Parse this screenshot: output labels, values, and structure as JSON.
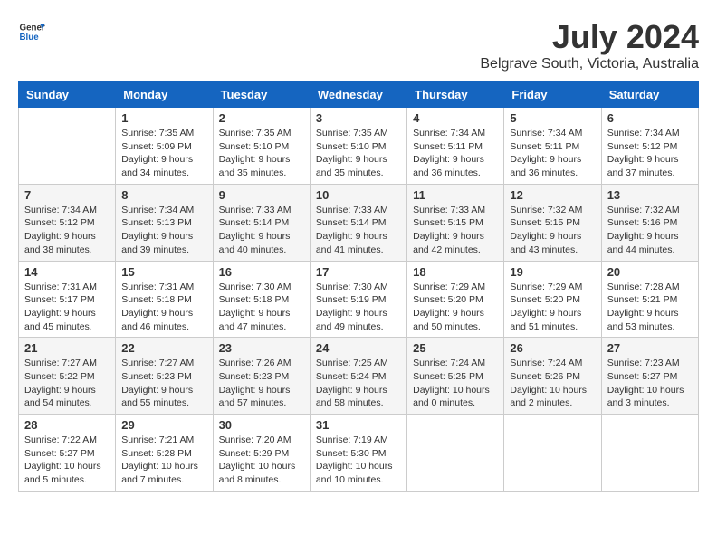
{
  "logo": {
    "line1": "General",
    "line2": "Blue"
  },
  "title": "July 2024",
  "location": "Belgrave South, Victoria, Australia",
  "weekdays": [
    "Sunday",
    "Monday",
    "Tuesday",
    "Wednesday",
    "Thursday",
    "Friday",
    "Saturday"
  ],
  "weeks": [
    [
      {
        "day": "",
        "info": ""
      },
      {
        "day": "1",
        "info": "Sunrise: 7:35 AM\nSunset: 5:09 PM\nDaylight: 9 hours\nand 34 minutes."
      },
      {
        "day": "2",
        "info": "Sunrise: 7:35 AM\nSunset: 5:10 PM\nDaylight: 9 hours\nand 35 minutes."
      },
      {
        "day": "3",
        "info": "Sunrise: 7:35 AM\nSunset: 5:10 PM\nDaylight: 9 hours\nand 35 minutes."
      },
      {
        "day": "4",
        "info": "Sunrise: 7:34 AM\nSunset: 5:11 PM\nDaylight: 9 hours\nand 36 minutes."
      },
      {
        "day": "5",
        "info": "Sunrise: 7:34 AM\nSunset: 5:11 PM\nDaylight: 9 hours\nand 36 minutes."
      },
      {
        "day": "6",
        "info": "Sunrise: 7:34 AM\nSunset: 5:12 PM\nDaylight: 9 hours\nand 37 minutes."
      }
    ],
    [
      {
        "day": "7",
        "info": "Sunrise: 7:34 AM\nSunset: 5:12 PM\nDaylight: 9 hours\nand 38 minutes."
      },
      {
        "day": "8",
        "info": "Sunrise: 7:34 AM\nSunset: 5:13 PM\nDaylight: 9 hours\nand 39 minutes."
      },
      {
        "day": "9",
        "info": "Sunrise: 7:33 AM\nSunset: 5:14 PM\nDaylight: 9 hours\nand 40 minutes."
      },
      {
        "day": "10",
        "info": "Sunrise: 7:33 AM\nSunset: 5:14 PM\nDaylight: 9 hours\nand 41 minutes."
      },
      {
        "day": "11",
        "info": "Sunrise: 7:33 AM\nSunset: 5:15 PM\nDaylight: 9 hours\nand 42 minutes."
      },
      {
        "day": "12",
        "info": "Sunrise: 7:32 AM\nSunset: 5:15 PM\nDaylight: 9 hours\nand 43 minutes."
      },
      {
        "day": "13",
        "info": "Sunrise: 7:32 AM\nSunset: 5:16 PM\nDaylight: 9 hours\nand 44 minutes."
      }
    ],
    [
      {
        "day": "14",
        "info": "Sunrise: 7:31 AM\nSunset: 5:17 PM\nDaylight: 9 hours\nand 45 minutes."
      },
      {
        "day": "15",
        "info": "Sunrise: 7:31 AM\nSunset: 5:18 PM\nDaylight: 9 hours\nand 46 minutes."
      },
      {
        "day": "16",
        "info": "Sunrise: 7:30 AM\nSunset: 5:18 PM\nDaylight: 9 hours\nand 47 minutes."
      },
      {
        "day": "17",
        "info": "Sunrise: 7:30 AM\nSunset: 5:19 PM\nDaylight: 9 hours\nand 49 minutes."
      },
      {
        "day": "18",
        "info": "Sunrise: 7:29 AM\nSunset: 5:20 PM\nDaylight: 9 hours\nand 50 minutes."
      },
      {
        "day": "19",
        "info": "Sunrise: 7:29 AM\nSunset: 5:20 PM\nDaylight: 9 hours\nand 51 minutes."
      },
      {
        "day": "20",
        "info": "Sunrise: 7:28 AM\nSunset: 5:21 PM\nDaylight: 9 hours\nand 53 minutes."
      }
    ],
    [
      {
        "day": "21",
        "info": "Sunrise: 7:27 AM\nSunset: 5:22 PM\nDaylight: 9 hours\nand 54 minutes."
      },
      {
        "day": "22",
        "info": "Sunrise: 7:27 AM\nSunset: 5:23 PM\nDaylight: 9 hours\nand 55 minutes."
      },
      {
        "day": "23",
        "info": "Sunrise: 7:26 AM\nSunset: 5:23 PM\nDaylight: 9 hours\nand 57 minutes."
      },
      {
        "day": "24",
        "info": "Sunrise: 7:25 AM\nSunset: 5:24 PM\nDaylight: 9 hours\nand 58 minutes."
      },
      {
        "day": "25",
        "info": "Sunrise: 7:24 AM\nSunset: 5:25 PM\nDaylight: 10 hours\nand 0 minutes."
      },
      {
        "day": "26",
        "info": "Sunrise: 7:24 AM\nSunset: 5:26 PM\nDaylight: 10 hours\nand 2 minutes."
      },
      {
        "day": "27",
        "info": "Sunrise: 7:23 AM\nSunset: 5:27 PM\nDaylight: 10 hours\nand 3 minutes."
      }
    ],
    [
      {
        "day": "28",
        "info": "Sunrise: 7:22 AM\nSunset: 5:27 PM\nDaylight: 10 hours\nand 5 minutes."
      },
      {
        "day": "29",
        "info": "Sunrise: 7:21 AM\nSunset: 5:28 PM\nDaylight: 10 hours\nand 7 minutes."
      },
      {
        "day": "30",
        "info": "Sunrise: 7:20 AM\nSunset: 5:29 PM\nDaylight: 10 hours\nand 8 minutes."
      },
      {
        "day": "31",
        "info": "Sunrise: 7:19 AM\nSunset: 5:30 PM\nDaylight: 10 hours\nand 10 minutes."
      },
      {
        "day": "",
        "info": ""
      },
      {
        "day": "",
        "info": ""
      },
      {
        "day": "",
        "info": ""
      }
    ]
  ]
}
